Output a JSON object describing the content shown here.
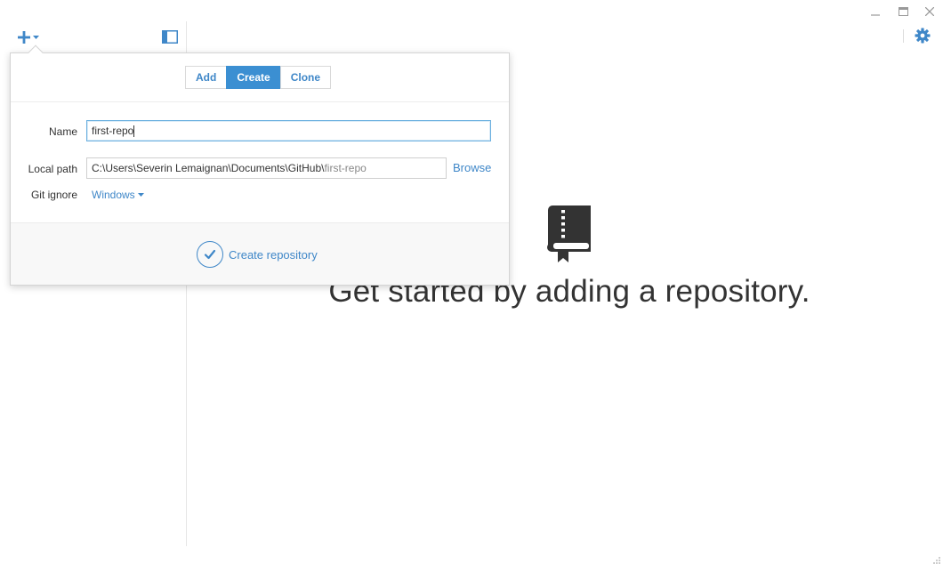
{
  "colors": {
    "accent": "#3b8fd2",
    "link": "#3f87c8",
    "border": "#d4d4d4"
  },
  "toolbar": {
    "add_icon": "plus-icon",
    "add_dropdown_icon": "caret-down-icon",
    "sidebar_toggle_icon": "sidebar-toggle-icon",
    "settings_icon": "gear-icon"
  },
  "window_controls": {
    "minimize": "minimize-icon",
    "maximize": "maximize-icon",
    "close": "close-icon"
  },
  "popover": {
    "tabs": [
      {
        "label": "Add",
        "active": false
      },
      {
        "label": "Create",
        "active": true
      },
      {
        "label": "Clone",
        "active": false
      }
    ],
    "name": {
      "label": "Name",
      "value": "first-repo"
    },
    "local_path": {
      "label": "Local path",
      "value_base": "C:\\Users\\Severin Lemaignan\\Documents\\GitHub\\",
      "value_suffix": "first-repo",
      "browse_label": "Browse"
    },
    "git_ignore": {
      "label": "Git ignore",
      "value": "Windows"
    },
    "create_button_label": "Create repository"
  },
  "main": {
    "empty_icon": "repository-book-icon",
    "empty_message": "Get started by adding a repository."
  }
}
